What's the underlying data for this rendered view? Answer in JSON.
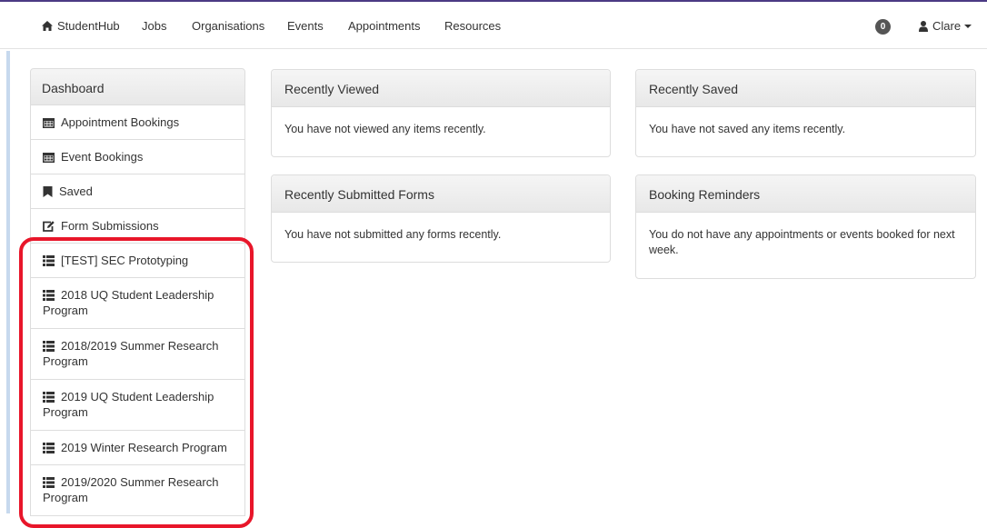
{
  "nav": {
    "brand": "StudentHub",
    "items": [
      "Jobs",
      "Organisations",
      "Events",
      "Appointments",
      "Resources"
    ],
    "notification_count": "0",
    "user_name": "Clare"
  },
  "sidebar": {
    "header": "Dashboard",
    "items": [
      {
        "label": "Appointment Bookings",
        "icon": "calendar-icon"
      },
      {
        "label": "Event Bookings",
        "icon": "calendar-icon"
      },
      {
        "label": "Saved",
        "icon": "bookmark-icon"
      },
      {
        "label": "Form Submissions",
        "icon": "edit-icon"
      },
      {
        "label": "[TEST] SEC Prototyping",
        "icon": "list-icon"
      },
      {
        "label": "2018 UQ Student Leadership Program",
        "icon": "list-icon"
      },
      {
        "label": "2018/2019 Summer Research Program",
        "icon": "list-icon"
      },
      {
        "label": "2019 UQ Student Leadership Program",
        "icon": "list-icon"
      },
      {
        "label": "2019 Winter Research Program",
        "icon": "list-icon"
      },
      {
        "label": "2019/2020 Summer Research Program",
        "icon": "list-icon"
      }
    ]
  },
  "panels": {
    "recently_viewed": {
      "title": "Recently Viewed",
      "body": "You have not viewed any items recently."
    },
    "recently_saved": {
      "title": "Recently Saved",
      "body": "You have not saved any items recently."
    },
    "recent_forms": {
      "title": "Recently Submitted Forms",
      "body": "You have not submitted any forms recently."
    },
    "booking_reminders": {
      "title": "Booking Reminders",
      "body": "You do not have any appointments or events booked for next week."
    }
  },
  "colors": {
    "highlight": "#e8162a",
    "top_rule": "#4b3a84",
    "badge": "#555555"
  }
}
